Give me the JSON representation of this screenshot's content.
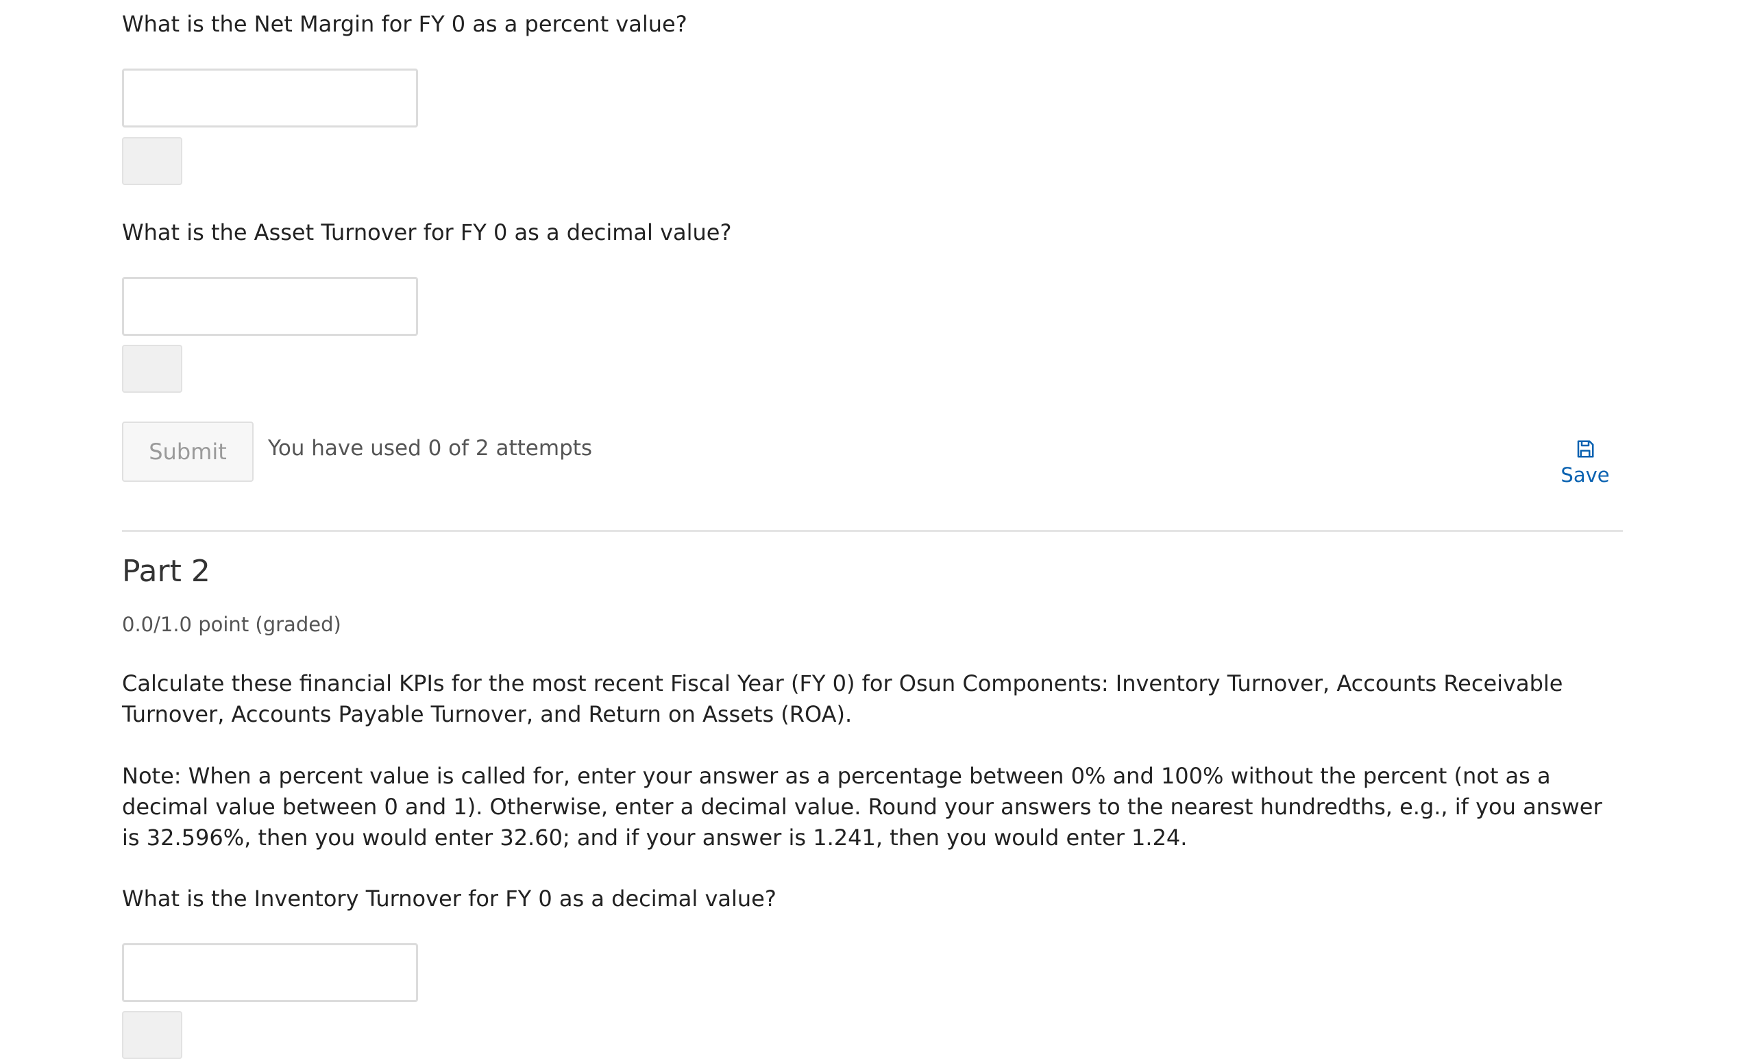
{
  "part1": {
    "q_net_margin": "What is the Net Margin for FY 0 as a percent value?",
    "q_asset_turnover": "What is the Asset Turnover for FY 0 as a decimal value?",
    "submit_label": "Submit",
    "attempts_text": "You have used 0 of 2 attempts",
    "save_label": "Save",
    "save_icon": "save-icon"
  },
  "part2": {
    "title": "Part 2",
    "points": "0.0/1.0 point (graded)",
    "intro": "Calculate these financial KPIs for the most recent Fiscal Year (FY 0) for Osun Components: Inventory Turnover, Accounts Receivable Turnover, Accounts Payable Turnover, and Return on Assets (ROA).",
    "note": "Note: When a percent value is called for, enter your answer as a percentage between 0% and 100% without the percent (not as a decimal value between 0 and 1). Otherwise, enter a decimal value. Round your answers to the nearest hundredths, e.g., if you answer is 32.596%, then you would enter 32.60; and if your answer is 1.241, then you would enter 1.24.",
    "q_inventory_turnover": "What is the Inventory Turnover for FY 0 as a decimal value?"
  },
  "colors": {
    "link": "#0a62b1",
    "divider": "#e4e4e4",
    "input_border": "#dcdcdc"
  }
}
